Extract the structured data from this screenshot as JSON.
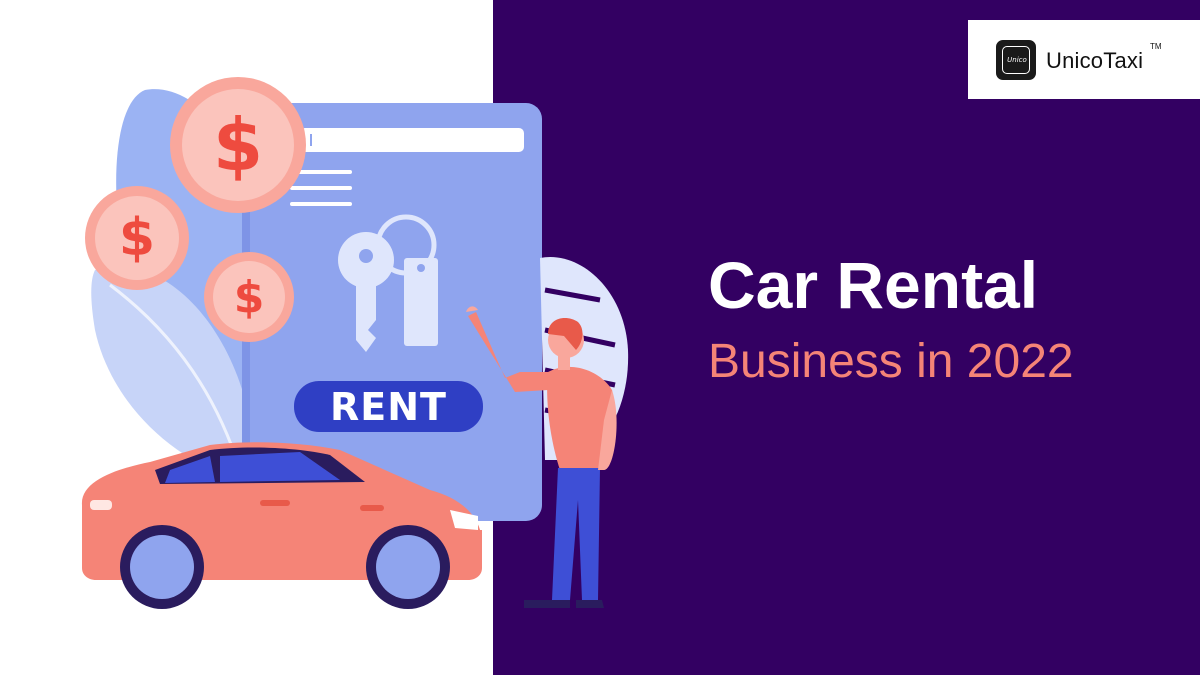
{
  "logo": {
    "mark_text": "Unico",
    "name": "UnicoTaxi",
    "tm": "TM"
  },
  "headline": {
    "title": "Car Rental",
    "subtitle": "Business in 2022"
  },
  "illustration": {
    "sign_label": "RENT",
    "coin_symbol": "$"
  },
  "colors": {
    "background_right": "#330062",
    "background_left": "#ffffff",
    "title": "#ffffff",
    "subtitle": "#f58477",
    "car_body": "#f58477",
    "document": "#8fa4ee",
    "rent_button": "#2f3fc4",
    "coin": "#f9a79c"
  },
  "icons": [
    "key-icon",
    "dollar-coin-icon",
    "car-icon",
    "leaf-icon"
  ]
}
